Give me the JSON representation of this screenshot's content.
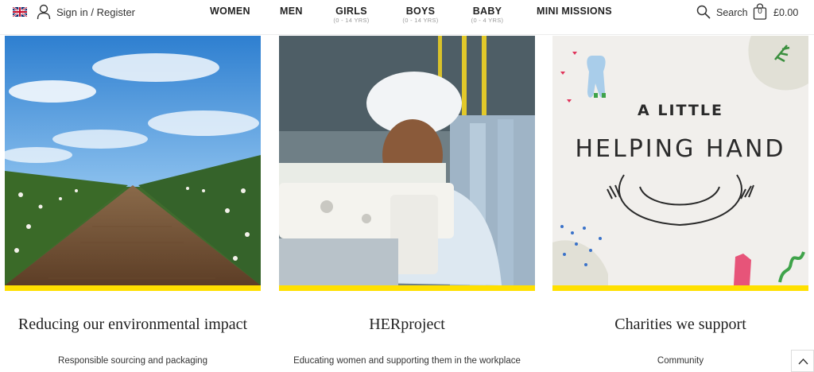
{
  "header": {
    "language_flag": "uk-flag-icon",
    "account_icon": "user-icon",
    "sign_in": "Sign in",
    "separator": " / ",
    "register": "Register",
    "nav": [
      {
        "label": "WOMEN",
        "sub": ""
      },
      {
        "label": "MEN",
        "sub": ""
      },
      {
        "label": "GIRLS",
        "sub": "(0 - 14 YRS)"
      },
      {
        "label": "BOYS",
        "sub": "(0 - 14 YRS)"
      },
      {
        "label": "BABY",
        "sub": "(0 - 4 YRS)"
      },
      {
        "label": "MINI MISSIONS",
        "sub": ""
      }
    ],
    "search_icon": "search-icon",
    "search_label": "Search",
    "bag_icon": "shopping-bag-icon",
    "bag_count": "0",
    "bag_total": "£0.00"
  },
  "cards": [
    {
      "title": "Reducing our environmental impact",
      "subtitle": "Responsible sourcing and packaging",
      "image": "cotton-field-photo"
    },
    {
      "title": "HERproject",
      "subtitle": "Educating women and supporting them in the workplace",
      "image": "factory-worker-photo"
    },
    {
      "title": "Charities we support",
      "subtitle": "Community",
      "image": "helping-hand-illustration",
      "image_text_1": "A LITTLE",
      "image_text_2": "HELPING HAND"
    }
  ],
  "colors": {
    "accent_bar": "#ffe000",
    "text": "#222222"
  },
  "scroll_top_icon": "chevron-up-icon"
}
